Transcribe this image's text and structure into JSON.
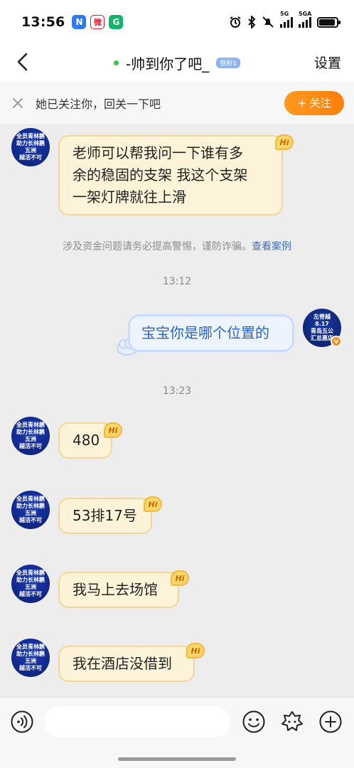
{
  "status_bar": {
    "time": "13:56",
    "apps": [
      "N",
      "微",
      "G"
    ],
    "signal1_label": "5G",
    "signal2_label": "5GA",
    "battery_level": 0.9
  },
  "header": {
    "title": "-帅到你了吧_",
    "fan_badge": "铁粉1",
    "settings_label": "设置"
  },
  "follow_bar": {
    "text": "她已关注你，回关一下吧",
    "button_label": "+ 关注"
  },
  "contact": {
    "avatar_lines": [
      "全员青林鹏",
      "助力长林鹏",
      "五洲",
      "越活不可"
    ]
  },
  "me": {
    "avatar_lines": [
      "左脊越8.17",
      "青岛五公",
      "汇总惠店"
    ],
    "verified": "v"
  },
  "messages": {
    "m1": {
      "lines": [
        "老师可以帮我问一下谁有多",
        "余的稳固的支架 我这个支架",
        "一架灯牌就往上滑"
      ],
      "badge": "Hi"
    },
    "notice_text": "涉及资金问题请务必提高警惕，谨防诈骗。",
    "notice_link": "查看案例",
    "time1": "13:12",
    "m2": {
      "text": "宝宝你是哪个位置的"
    },
    "time2": "13:23",
    "m3": {
      "text": "480",
      "badge": "Hi"
    },
    "m4": {
      "text": "53排17号",
      "badge": "Hi"
    },
    "m5": {
      "text": "我马上去场馆",
      "badge": "Hi"
    },
    "m6": {
      "text": "我在酒店没借到",
      "badge": "Hi"
    }
  },
  "icons": {
    "back": "chevron-left-icon",
    "close": "close-icon",
    "voice": "voice-icon",
    "emoji": "emoji-icon",
    "sticker": "sticker-icon",
    "plus": "plus-icon"
  },
  "colors": {
    "follow_button": "#ff8a14",
    "incoming_bubble": "#fdf3d9",
    "outgoing_bubble": "#eef4ff",
    "link": "#3a6fc4",
    "online": "#35c84a"
  }
}
